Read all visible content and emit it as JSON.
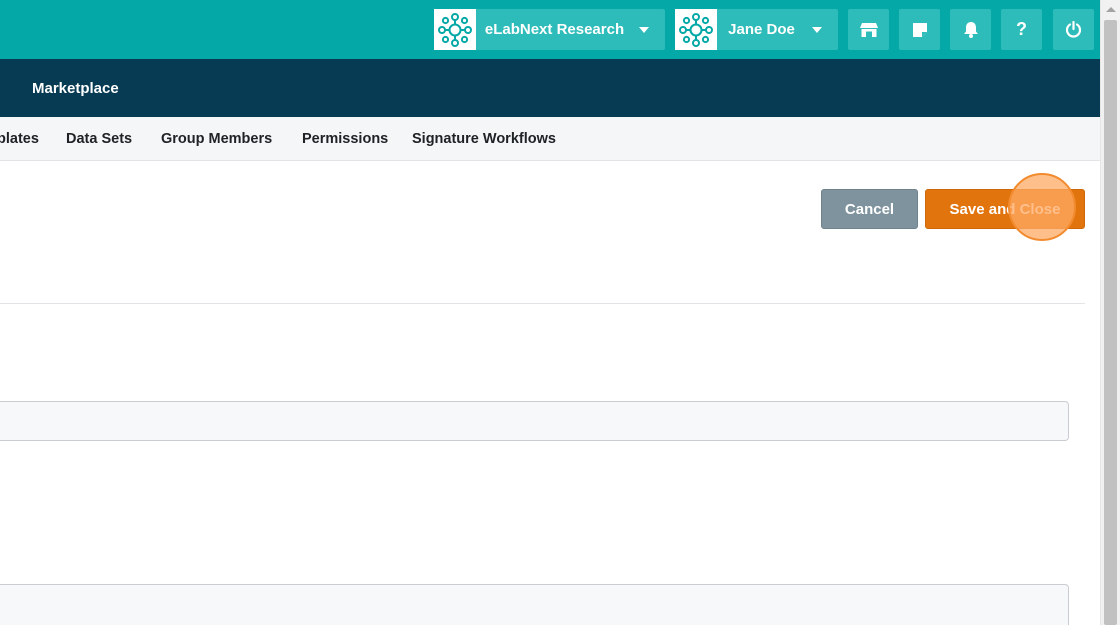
{
  "header": {
    "organization": {
      "name": "eLabNext Research",
      "icon": "network-logo-icon"
    },
    "user": {
      "name": "Jane Doe",
      "icon": "network-logo-icon"
    },
    "icons": [
      "store-icon",
      "notes-icon",
      "bell-icon",
      "help-icon",
      "power-icon"
    ],
    "help_label": "?"
  },
  "navbar": {
    "items": [
      {
        "label": "Marketplace"
      }
    ]
  },
  "tabs": [
    {
      "label": "plates"
    },
    {
      "label": "Data Sets"
    },
    {
      "label": "Group Members"
    },
    {
      "label": "Permissions"
    },
    {
      "label": "Signature Workflows"
    }
  ],
  "actions": {
    "cancel_label": "Cancel",
    "save_label": "Save and Close"
  },
  "colors": {
    "topbar": "#04a8a6",
    "topbar_button": "#2ebcba",
    "navbar": "#073b54",
    "cancel": "#7f939e",
    "save": "#e2740d"
  }
}
